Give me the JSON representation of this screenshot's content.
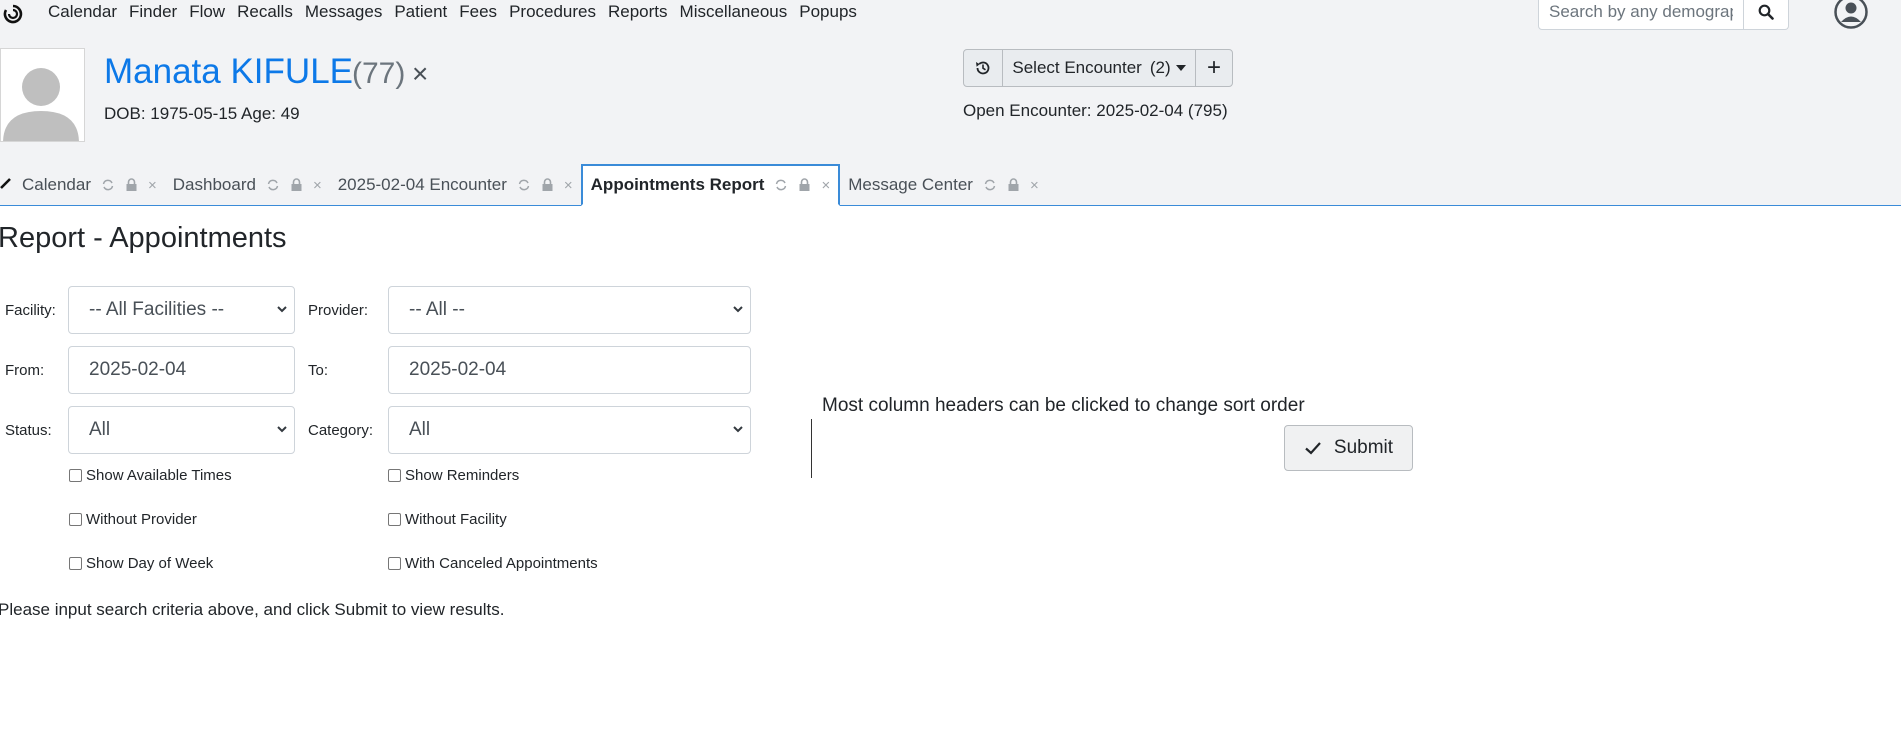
{
  "nav": {
    "items": [
      "Calendar",
      "Finder",
      "Flow",
      "Recalls",
      "Messages",
      "Patient",
      "Fees",
      "Procedures",
      "Reports",
      "Miscellaneous",
      "Popups"
    ],
    "search_placeholder": "Search by any demograph"
  },
  "patient": {
    "name": "Manata KIFULE",
    "age_badge": "(77)",
    "close": "×",
    "dob_line": "DOB: 1975-05-15 Age: 49"
  },
  "encounter": {
    "select_label": "Select Encounter",
    "count": "(2)",
    "add_label": "+",
    "open_line": "Open Encounter: 2025-02-04 (795)"
  },
  "tabs": [
    {
      "label": "Calendar",
      "active": false
    },
    {
      "label": "Dashboard",
      "active": false
    },
    {
      "label": "2025-02-04 Encounter",
      "active": false
    },
    {
      "label": "Appointments Report",
      "active": true
    },
    {
      "label": "Message Center",
      "active": false
    }
  ],
  "tab_close": "×",
  "report": {
    "title": "Report - Appointments",
    "facility_label": "Facility:",
    "facility_value": "-- All Facilities --",
    "provider_label": "Provider:",
    "provider_value": "-- All --",
    "from_label": "From:",
    "from_value": "2025-02-04",
    "to_label": "To:",
    "to_value": "2025-02-04",
    "status_label": "Status:",
    "status_value": "All",
    "category_label": "Category:",
    "category_value": "All",
    "checkboxes": {
      "show_available_times": "Show Available Times",
      "show_reminders": "Show Reminders",
      "without_provider": "Without Provider",
      "without_facility": "Without Facility",
      "show_day_of_week": "Show Day of Week",
      "with_canceled": "With Canceled Appointments"
    },
    "hint": "Most column headers can be clicked to change sort order",
    "submit_label": "Submit",
    "notice": "Please input search criteria above, and click Submit to view results."
  },
  "colors": {
    "accent": "#0d79e8",
    "tab_border": "#3a8bd8",
    "header_bg": "#f2f3f5"
  }
}
